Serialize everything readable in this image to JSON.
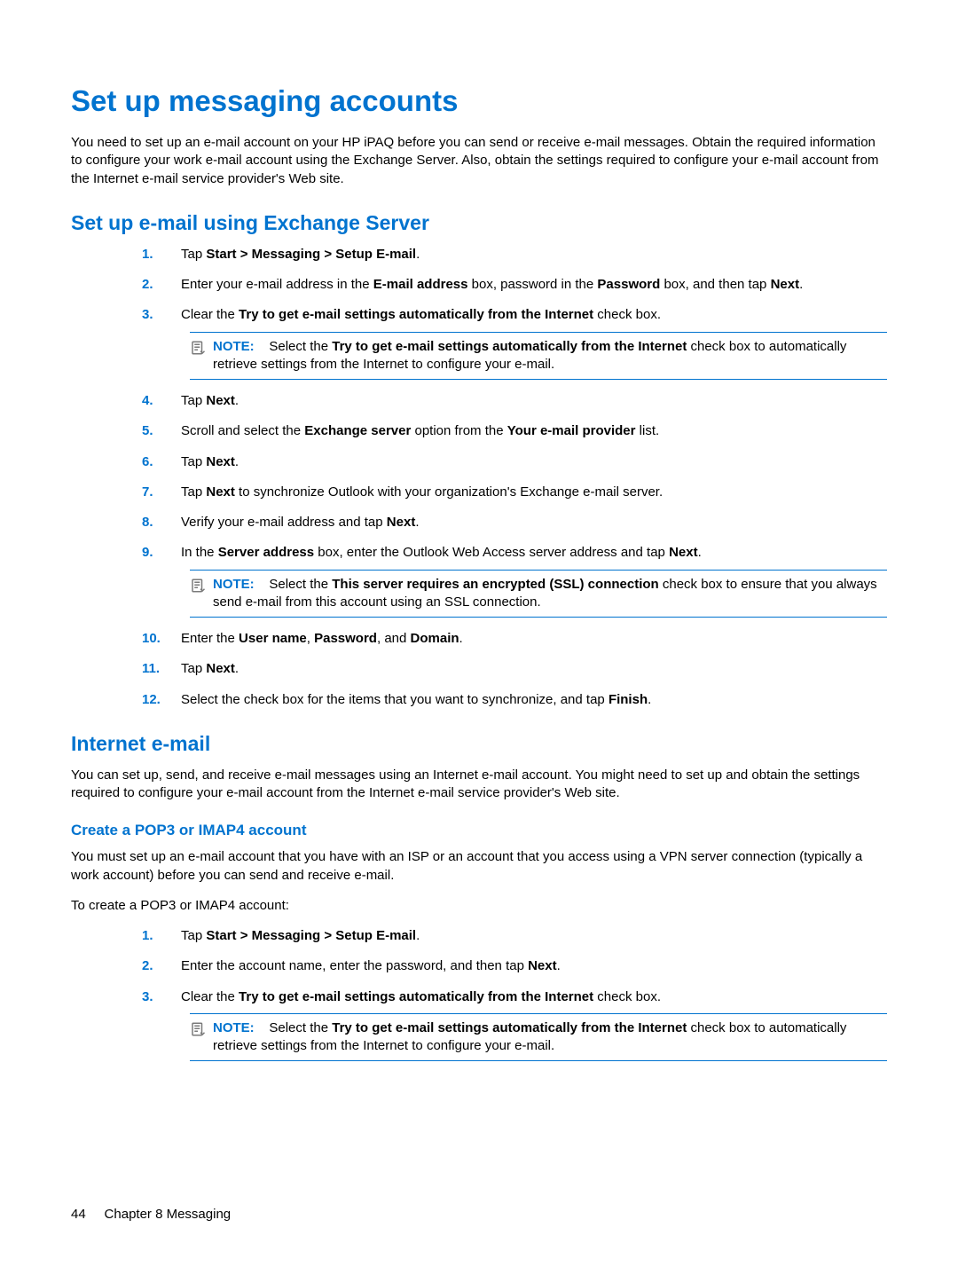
{
  "headings": {
    "h1": "Set up messaging accounts",
    "h2a": "Set up e-mail using Exchange Server",
    "h2b": "Internet e-mail",
    "h3": "Create a POP3 or IMAP4 account"
  },
  "intro1": "You need to set up an e-mail account on your HP iPAQ before you can send or receive e-mail messages. Obtain the required information to configure your work e-mail account using the Exchange Server. Also, obtain the settings required to configure your e-mail account from the Internet e-mail service provider's Web site.",
  "note_label": "NOTE:",
  "exchange_steps": {
    "n1": "1.",
    "n2": "2.",
    "n3": "3.",
    "n4": "4.",
    "n5": "5.",
    "n6": "6.",
    "n7": "7.",
    "n8": "8.",
    "n9": "9.",
    "n10": "10.",
    "n11": "11.",
    "n12": "12.",
    "s1_a": "Tap ",
    "s1_b": "Start > Messaging > Setup E-mail",
    "s1_c": ".",
    "s2_a": "Enter your e-mail address in the ",
    "s2_b": "E-mail address",
    "s2_c": " box, password in the ",
    "s2_d": "Password",
    "s2_e": " box, and then tap ",
    "s2_f": "Next",
    "s2_g": ".",
    "s3_a": "Clear the ",
    "s3_b": "Try to get e-mail settings automatically from the Internet",
    "s3_c": " check box.",
    "note3_a": "Select the ",
    "note3_b": "Try to get e-mail settings automatically from the Internet",
    "note3_c": " check box to automatically retrieve settings from the Internet to configure your e-mail.",
    "s4_a": "Tap ",
    "s4_b": "Next",
    "s4_c": ".",
    "s5_a": "Scroll and select the ",
    "s5_b": "Exchange server",
    "s5_c": " option from the ",
    "s5_d": "Your e-mail provider",
    "s5_e": " list.",
    "s6_a": "Tap ",
    "s6_b": "Next",
    "s6_c": ".",
    "s7_a": "Tap ",
    "s7_b": "Next",
    "s7_c": " to synchronize Outlook with your organization's Exchange e-mail server.",
    "s8_a": "Verify your e-mail address and tap ",
    "s8_b": "Next",
    "s8_c": ".",
    "s9_a": "In the ",
    "s9_b": "Server address",
    "s9_c": " box, enter the Outlook Web Access server address and tap ",
    "s9_d": "Next",
    "s9_e": ".",
    "note9_a": "Select the ",
    "note9_b": "This server requires an encrypted (SSL) connection",
    "note9_c": " check box to ensure that you always send e-mail from this account using an SSL connection.",
    "s10_a": "Enter the ",
    "s10_b": "User name",
    "s10_c": ", ",
    "s10_d": "Password",
    "s10_e": ", and ",
    "s10_f": "Domain",
    "s10_g": ".",
    "s11_a": "Tap ",
    "s11_b": "Next",
    "s11_c": ".",
    "s12_a": "Select the check box for the items that you want to synchronize, and tap ",
    "s12_b": "Finish",
    "s12_c": "."
  },
  "internet_intro": "You can set up, send, and receive e-mail messages using an Internet e-mail account. You might need to set up and obtain the settings required to configure your e-mail account from the Internet e-mail service provider's Web site.",
  "pop3_intro1": "You must set up an e-mail account that you have with an ISP or an account that you access using a VPN server connection (typically a work account) before you can send and receive e-mail.",
  "pop3_intro2": "To create a POP3 or IMAP4 account:",
  "pop3_steps": {
    "n1": "1.",
    "n2": "2.",
    "n3": "3.",
    "s1_a": "Tap ",
    "s1_b": "Start > Messaging > Setup E-mail",
    "s1_c": ".",
    "s2_a": "Enter the account name, enter the password, and then tap ",
    "s2_b": "Next",
    "s2_c": ".",
    "s3_a": "Clear the ",
    "s3_b": "Try to get e-mail settings automatically from the Internet",
    "s3_c": " check box.",
    "note3_a": "Select the ",
    "note3_b": "Try to get e-mail settings automatically from the Internet",
    "note3_c": " check box to automatically retrieve settings from the Internet to configure your e-mail."
  },
  "footer": {
    "page": "44",
    "chapter": "Chapter 8   Messaging"
  }
}
